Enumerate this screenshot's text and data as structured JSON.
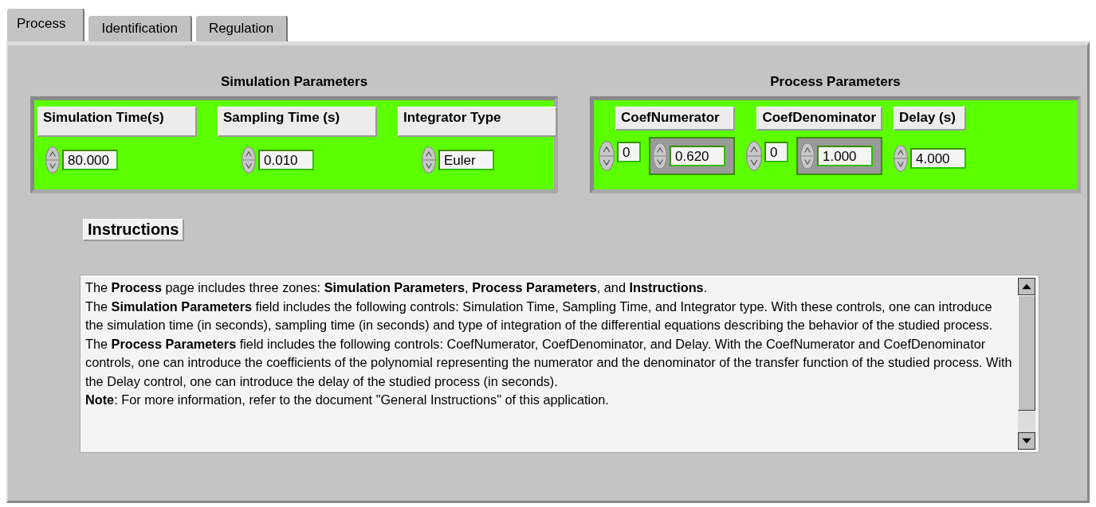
{
  "tabs": [
    {
      "label": "Process",
      "selected": true
    },
    {
      "label": "Identification",
      "selected": false
    },
    {
      "label": "Regulation",
      "selected": false
    }
  ],
  "simulation_parameters": {
    "title": "Simulation Parameters",
    "controls": [
      {
        "label": "Simulation Time(s)",
        "value": "80.000"
      },
      {
        "label": "Sampling Time (s)",
        "value": "0.010"
      },
      {
        "label": "Integrator Type",
        "value": "Euler"
      }
    ]
  },
  "process_parameters": {
    "title": "Process Parameters",
    "controls": [
      {
        "kind": "array",
        "label": "CoefNumerator",
        "index": "0",
        "value": "0.620"
      },
      {
        "kind": "array",
        "label": "CoefDenominator",
        "index": "0",
        "value": "1.000"
      },
      {
        "kind": "numeric",
        "label": "Delay (s)",
        "value": "4.000"
      }
    ]
  },
  "instructions": {
    "label": "Instructions",
    "paragraphs": [
      "The **Process** page includes three zones: **Simulation Parameters**, **Process Parameters**, and **Instructions**.",
      "The **Simulation Parameters** field includes the following controls: Simulation Time, Sampling Time, and Integrator type. With these controls, one can introduce the simulation time (in seconds), sampling time (in seconds) and type of integration of the differential equations describing the behavior of the studied process.",
      "The **Process Parameters** field includes the following controls: CoefNumerator, CoefDenominator, and Delay. With the CoefNumerator and CoefDenominator controls, one can introduce the coefficients of the polynomial representing the numerator and the denominator of the transfer function of the studied process. With the Delay control, one can introduce the delay of the studied process (in seconds).",
      "**Note**: For more information, refer to the document \"General Instructions\" of this application."
    ]
  }
}
